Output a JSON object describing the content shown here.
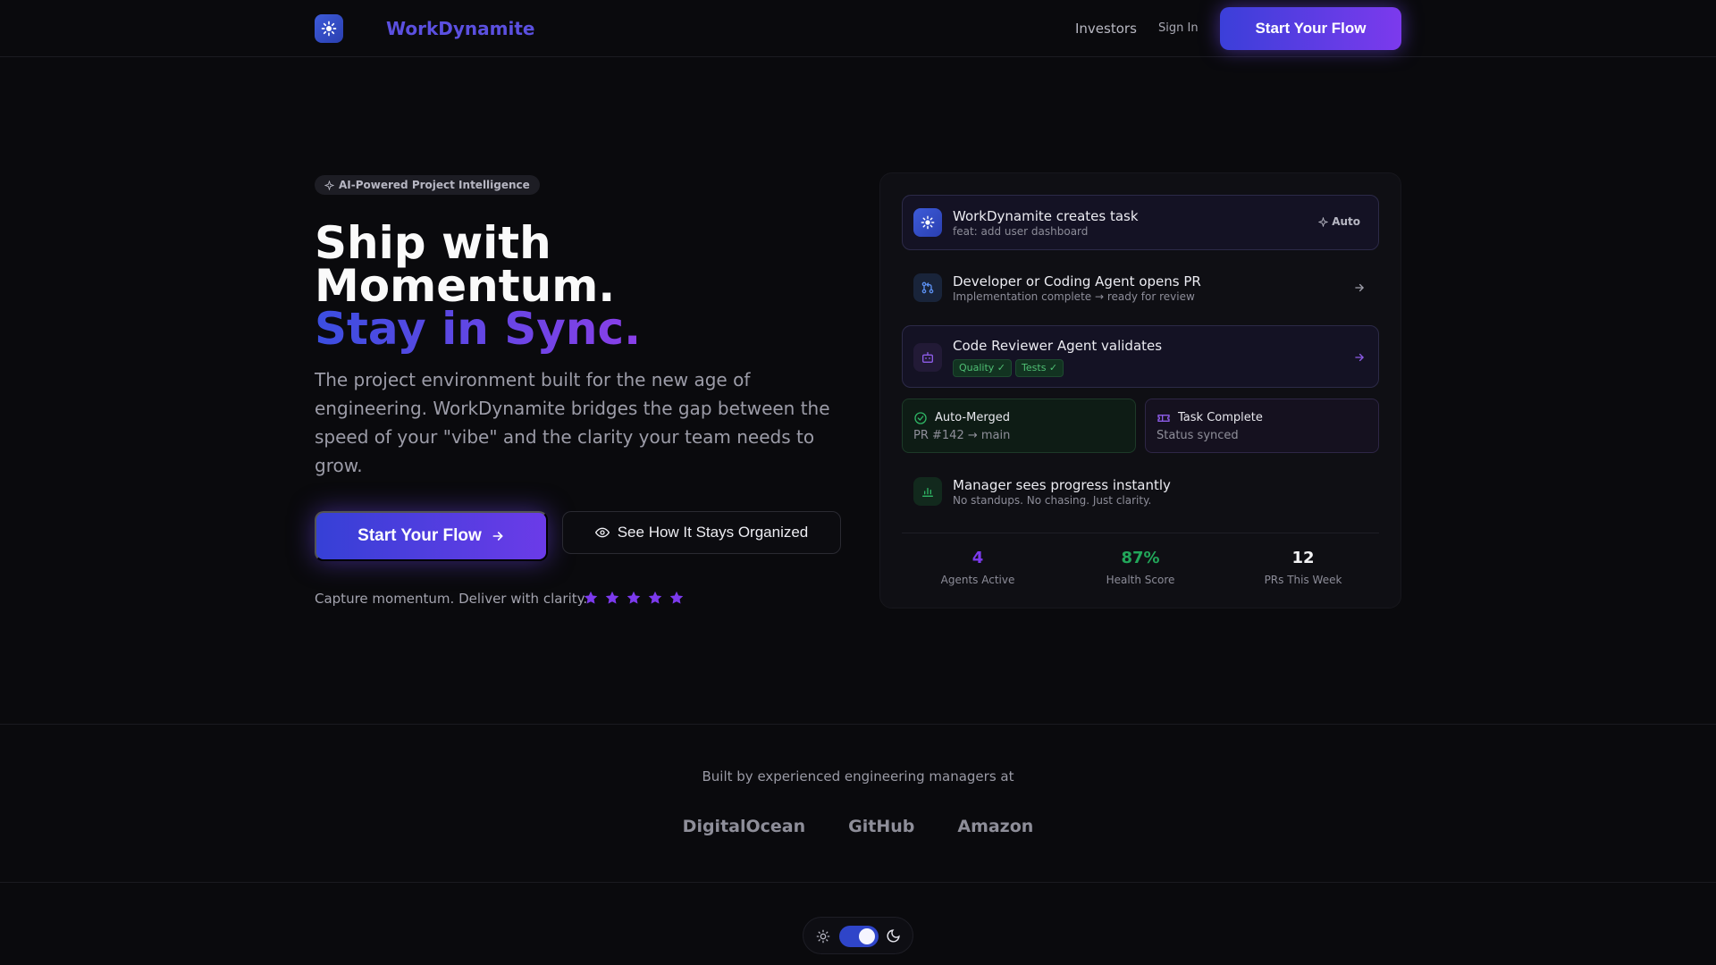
{
  "header": {
    "brand": "WorkDynamite",
    "nav": {
      "investors": "Investors",
      "sign_in": "Sign In"
    },
    "cta": "Start Your Flow"
  },
  "hero": {
    "pill": "AI-Powered Project Intelligence",
    "title_line1": "Ship with",
    "title_line2": "Momentum.",
    "title_line3": "Stay in Sync.",
    "description": "The project environment built for the new age of engineering. WorkDynamite bridges the gap between the speed of your \"vibe\" and the clarity your team needs to grow.",
    "cta_primary": "Start Your Flow",
    "cta_secondary": "See How It Stays Organized",
    "tagline": "Capture momentum. Deliver with clarity.",
    "rating": 5
  },
  "workflow": {
    "steps": [
      {
        "title": "WorkDynamite creates task",
        "subtitle": "feat: add user dashboard",
        "badge": "Auto"
      },
      {
        "title": "Developer or Coding Agent opens PR",
        "subtitle": "Implementation complete → ready for review"
      },
      {
        "title": "Code Reviewer Agent validates",
        "tags": [
          "Quality ✓",
          "Tests ✓"
        ]
      },
      {
        "title": "Manager sees progress instantly",
        "subtitle": "No standups. No chasing. Just clarity."
      }
    ],
    "merged": {
      "title": "Auto-Merged",
      "subtitle": "PR #142 → main"
    },
    "complete": {
      "title": "Task Complete",
      "subtitle": "Status synced"
    },
    "stats": [
      {
        "value": "4",
        "label": "Agents Active",
        "color": "#7c3aed"
      },
      {
        "value": "87%",
        "label": "Health Score",
        "color": "#22a65a"
      },
      {
        "value": "12",
        "label": "PRs This Week",
        "color": "#f3f3f5"
      }
    ]
  },
  "social_proof": {
    "heading": "Built by experienced engineering managers at",
    "companies": [
      "DigitalOcean",
      "GitHub",
      "Amazon"
    ]
  },
  "theme": {
    "mode": "dark"
  },
  "colors": {
    "accent": "#5b50e0",
    "gradient_start": "#3b3fd9",
    "gradient_end": "#7c3aed",
    "success": "#22a65a"
  }
}
